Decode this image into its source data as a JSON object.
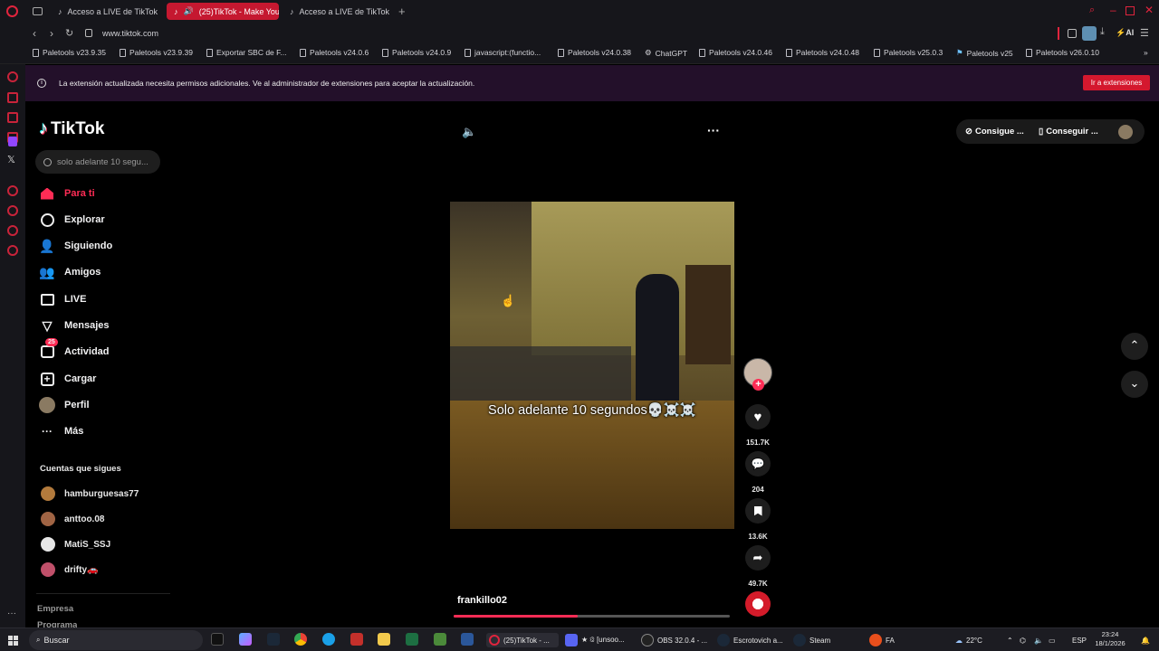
{
  "browser": {
    "tabs": [
      {
        "label": "Acceso a LIVE de TikTok",
        "active": false
      },
      {
        "label": "(25)TikTok - Make You",
        "active": true
      },
      {
        "label": "Acceso a LIVE de TikTok",
        "active": false
      }
    ],
    "url": "www.tiktok.com",
    "bookmarks": [
      "Paletools v23.9.35",
      "Paletools v23.9.39",
      "Exportar SBC de F...",
      "Paletools v24.0.6",
      "Paletools v24.0.9",
      "javascript:(functio...",
      "Paletools v24.0.38",
      "ChatGPT",
      "Paletools v24.0.46",
      "Paletools v24.0.48",
      "Paletools v25.0.3",
      "Paletools v25",
      "Paletools v26.0.10"
    ],
    "ai_label": "AI",
    "notice": {
      "text": "La extensión actualizada necesita permisos adicionales. Ve al administrador de extensiones para aceptar la actualización.",
      "button": "Ir a extensiones"
    }
  },
  "tiktok": {
    "logo": "TikTok",
    "search_placeholder": "solo adelante 10 segu...",
    "nav": [
      {
        "label": "Para ti",
        "icon": "home-icon"
      },
      {
        "label": "Explorar",
        "icon": "compass-icon"
      },
      {
        "label": "Siguiendo",
        "icon": "following-icon"
      },
      {
        "label": "Amigos",
        "icon": "friends-icon"
      },
      {
        "label": "LIVE",
        "icon": "live-icon"
      },
      {
        "label": "Mensajes",
        "icon": "send-icon"
      },
      {
        "label": "Actividad",
        "icon": "activity-icon"
      },
      {
        "label": "Cargar",
        "icon": "upload-icon"
      },
      {
        "label": "Perfil",
        "icon": "profile-avatar"
      },
      {
        "label": "Más",
        "icon": "more-icon"
      }
    ],
    "activity_badge": "25",
    "following_title": "Cuentas que sigues",
    "following": [
      "hamburguesas77",
      "anttoo.08",
      "MatiS_SSJ",
      "drifty🚗"
    ],
    "footer": [
      "Empresa",
      "Programa"
    ],
    "top_buttons": [
      "Consigue ...",
      "Conseguir ..."
    ],
    "video": {
      "caption": "Solo adelante 10 segundos💀☠️☠️",
      "author": "frankillo02",
      "progress": 0.45
    },
    "actions": {
      "likes": "151.7K",
      "comments": "204",
      "saves": "13.6K",
      "shares": "49.7K"
    }
  },
  "taskbar": {
    "search": "Buscar",
    "apps": [
      "(25)TikTok - ...",
      "★ 🕄 [unsoo...",
      "OBS 32.0.4 - ...",
      "Escrotovich a...",
      "Steam",
      "FA"
    ],
    "weather": "22°C",
    "lang": "ESP",
    "time": "23:24",
    "date": "18/1/2026"
  },
  "colors": {
    "brand": "#fe2c55",
    "tab_active": "#c51830",
    "notice_bg": "#23102a"
  }
}
